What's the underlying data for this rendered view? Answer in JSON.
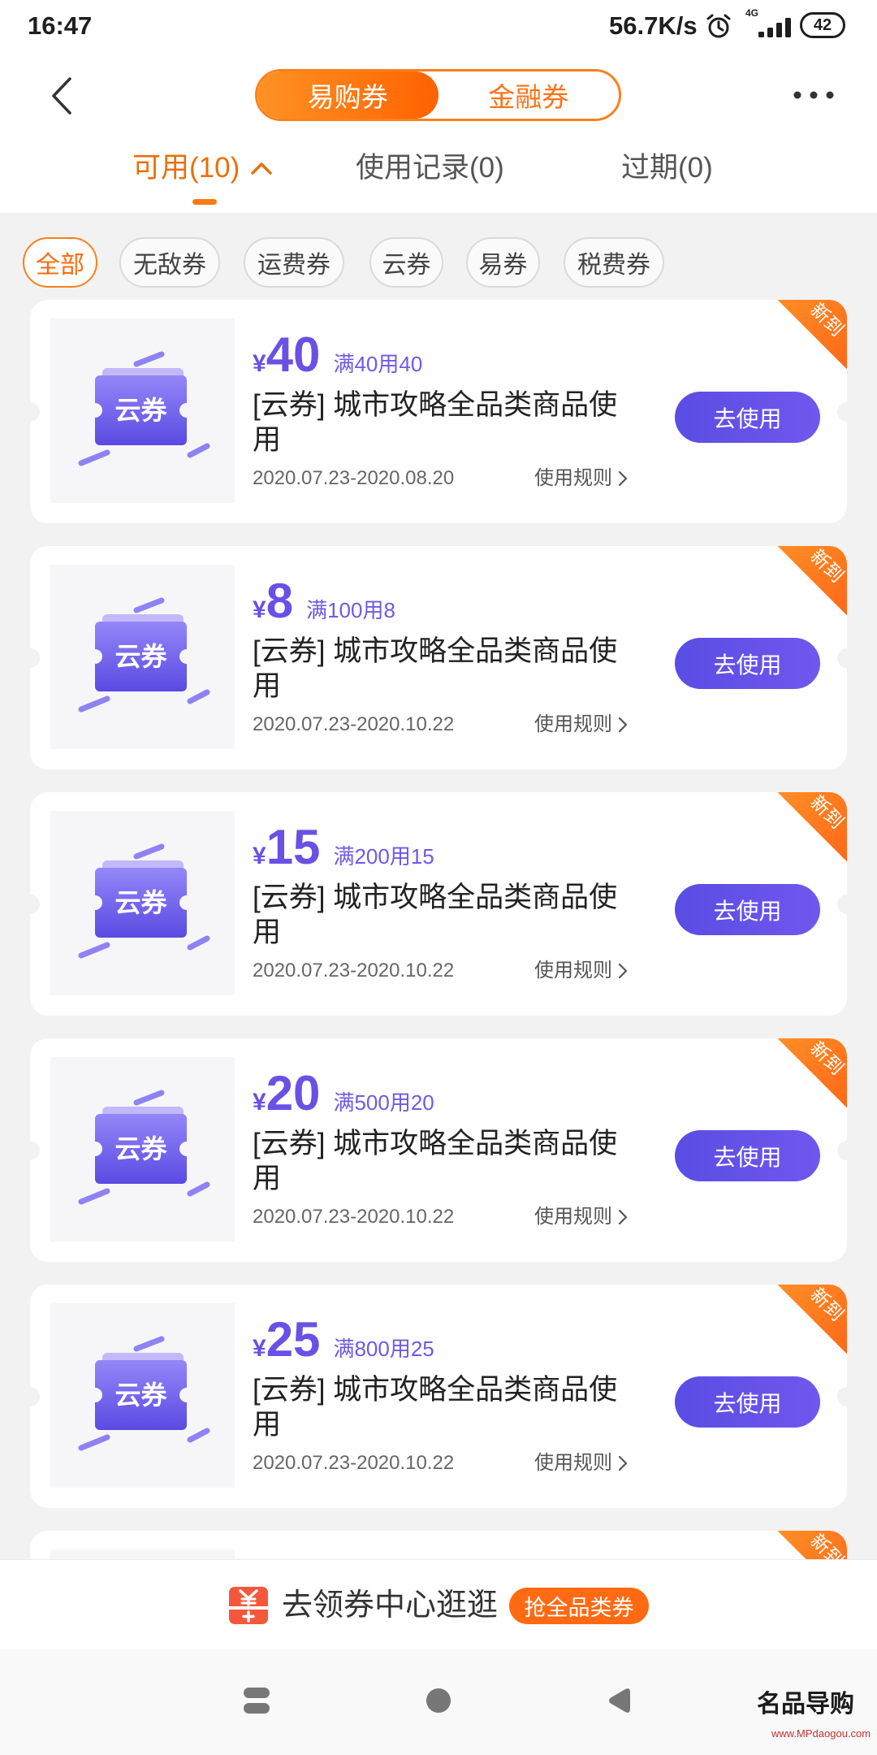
{
  "status_bar": {
    "time": "16:47",
    "net_speed": "56.7K/s",
    "network_type": "4G",
    "battery": "42",
    "icons": [
      "alarm-icon",
      "signal-icon",
      "battery-icon"
    ]
  },
  "header": {
    "back_icon": "back-arrow-icon",
    "more_icon": "more-icon",
    "segments": [
      {
        "label": "易购券",
        "active": true
      },
      {
        "label": "金融券",
        "active": false
      }
    ]
  },
  "tabs": [
    {
      "label": "可用(10)",
      "active": true,
      "icon": "chevron-up-icon"
    },
    {
      "label": "使用记录(0)",
      "active": false
    },
    {
      "label": "过期(0)",
      "active": false
    }
  ],
  "filters": [
    {
      "label": "全部",
      "active": true
    },
    {
      "label": "无敌券",
      "active": false
    },
    {
      "label": "运费券",
      "active": false
    },
    {
      "label": "云券",
      "active": false
    },
    {
      "label": "易券",
      "active": false
    },
    {
      "label": "税费券",
      "active": false
    }
  ],
  "coupons": [
    {
      "currency": "¥",
      "amount": "40",
      "condition": "满40用40",
      "title": "[云券] 城市攻略全品类商品使用",
      "validity": "2020.07.23-2020.08.20",
      "rules_label": "使用规则",
      "button_label": "去使用",
      "badge": "新到",
      "image_label": "云券"
    },
    {
      "currency": "¥",
      "amount": "8",
      "condition": "满100用8",
      "title": "[云券] 城市攻略全品类商品使用",
      "validity": "2020.07.23-2020.10.22",
      "rules_label": "使用规则",
      "button_label": "去使用",
      "badge": "新到",
      "image_label": "云券"
    },
    {
      "currency": "¥",
      "amount": "15",
      "condition": "满200用15",
      "title": "[云券] 城市攻略全品类商品使用",
      "validity": "2020.07.23-2020.10.22",
      "rules_label": "使用规则",
      "button_label": "去使用",
      "badge": "新到",
      "image_label": "云券"
    },
    {
      "currency": "¥",
      "amount": "20",
      "condition": "满500用20",
      "title": "[云券] 城市攻略全品类商品使用",
      "validity": "2020.07.23-2020.10.22",
      "rules_label": "使用规则",
      "button_label": "去使用",
      "badge": "新到",
      "image_label": "云券"
    },
    {
      "currency": "¥",
      "amount": "25",
      "condition": "满800用25",
      "title": "[云券] 城市攻略全品类商品使用",
      "validity": "2020.07.23-2020.10.22",
      "rules_label": "使用规则",
      "button_label": "去使用",
      "badge": "新到",
      "image_label": "云券"
    }
  ],
  "partial_coupon": {
    "badge": "新到"
  },
  "bottom_bar": {
    "icon": "coupon-center-icon",
    "text": "去领券中心逛逛",
    "badge": "抢全品类券"
  },
  "navigation_bar": {
    "icons": [
      "menu-icon",
      "home-icon",
      "back-icon"
    ]
  },
  "watermark": {
    "logo": "名品导购",
    "url": "www.MPdaogou.com"
  },
  "colors": {
    "accent": "#FF7A14",
    "coupon_purple": "#6A50E4",
    "badge_orange": "#FF6A13",
    "page_background": "#F2F2F2"
  }
}
